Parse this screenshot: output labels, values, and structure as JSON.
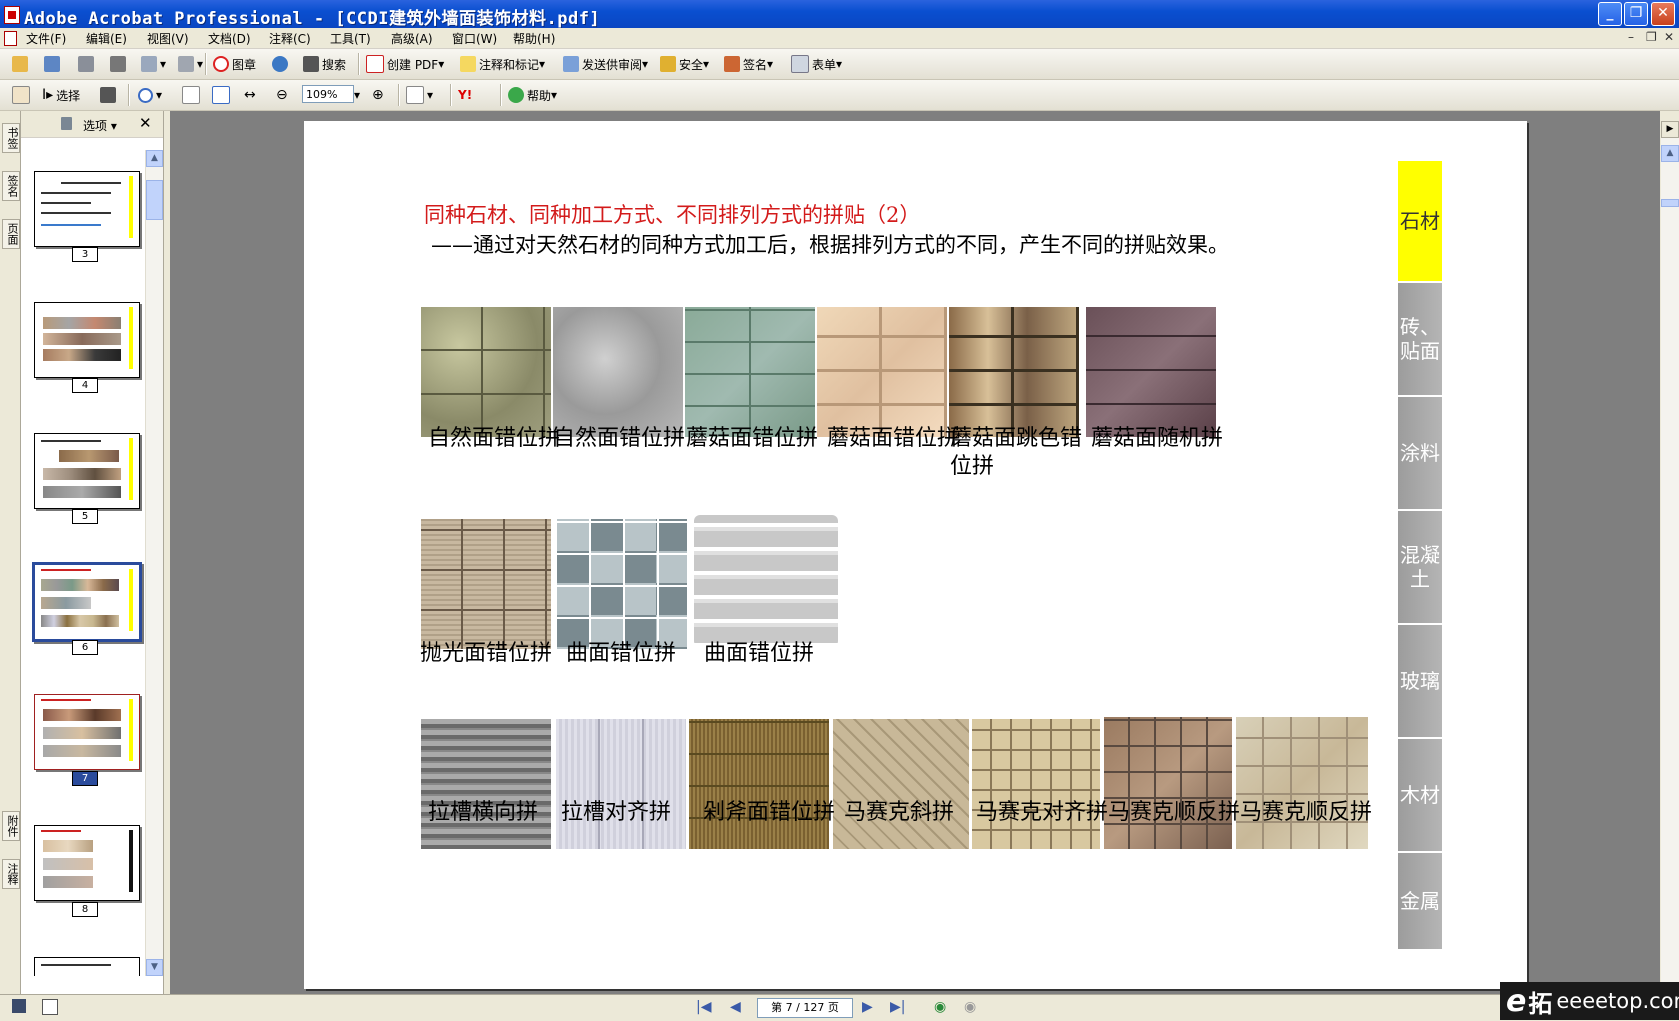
{
  "window": {
    "title": "Adobe Acrobat Professional - [CCDI建筑外墙面装饰材料.pdf]"
  },
  "menu": [
    "文件(F)",
    "编辑(E)",
    "视图(V)",
    "文档(D)",
    "注释(C)",
    "工具(T)",
    "高级(A)",
    "窗口(W)",
    "帮助(H)"
  ],
  "toolbar1": {
    "stamp": "图章",
    "search": "搜索",
    "create_pdf": "创建 PDF",
    "comment": "注释和标记",
    "send_review": "发送供审阅",
    "security": "安全",
    "sign": "签名",
    "forms": "表单"
  },
  "toolbar2": {
    "select": "选择",
    "zoom": "109%",
    "help": "帮助"
  },
  "left_tabs": [
    "书签",
    "签名",
    "页面",
    "附件",
    "注释"
  ],
  "panel": {
    "options": "选项"
  },
  "thumbnails": [
    "3",
    "4",
    "5",
    "6",
    "7",
    "8"
  ],
  "page": {
    "heading": "同种石材、同种加工方式、不同排列方式的拼贴（2）",
    "subheading": "——通过对天然石材的同种方式加工后，根据排列方式的不同，产生不同的拼贴效果。",
    "row1": [
      "自然面错位拼",
      "自然面错位拼",
      "蘑菇面错位拼",
      "蘑菇面错位拼",
      "蘑菇面跳色错位拼",
      "蘑菇面随机拼"
    ],
    "row2": [
      "抛光面错位拼",
      "曲面错位拼",
      "曲面错位拼"
    ],
    "row3": [
      "拉槽横向拼",
      "拉槽对齐拼",
      "剁斧面错位拼",
      "马赛克斜拼",
      "马赛克对齐拼",
      "马赛克顺反拼",
      "马赛克顺反拼"
    ],
    "sidenav": [
      "石材",
      "砖、贴面",
      "涂料",
      "混凝土",
      "玻璃",
      "木材",
      "金属"
    ]
  },
  "status": {
    "page_indicator": "第 7 / 127 页"
  },
  "watermark": {
    "e": "e",
    "tuo": "拓",
    "domain": "eeeetop.com"
  }
}
